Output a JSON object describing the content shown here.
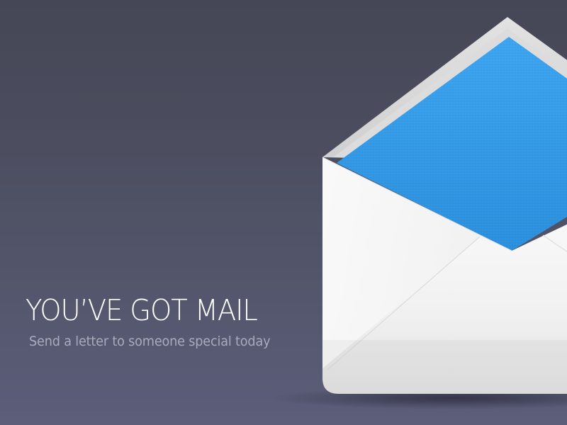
{
  "hero": {
    "headline": "YOU’VE GOT MAIL",
    "subline": "Send a letter to someone special today"
  },
  "illustration": {
    "icon": "envelope-open-icon"
  },
  "colors": {
    "background_top": "#454756",
    "background_bottom": "#5c5e7a",
    "headline": "#ffffff",
    "subline": "#a9abbc",
    "letter_blue": "#2e95e2",
    "envelope_white": "#f7f7f7"
  }
}
